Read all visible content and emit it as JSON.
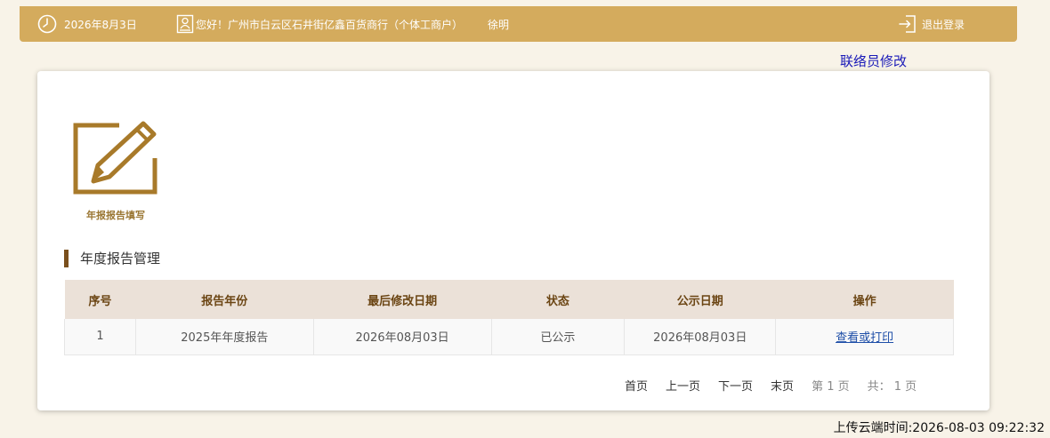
{
  "header": {
    "date": "2026年8月3日",
    "greeting": "您好！广州市白云区石井街亿鑫百货商行（个体工商户）",
    "user": "徐明",
    "logout": "退出登录"
  },
  "liaison_link": "联络员修改",
  "report_fill": {
    "label": "年报报告填写"
  },
  "section_title": "年度报告管理",
  "table": {
    "headers": [
      "序号",
      "报告年份",
      "最后修改日期",
      "状态",
      "公示日期",
      "操作"
    ],
    "rows": [
      {
        "index": "1",
        "year": "2025年年度报告",
        "modified": "2026年08月03日",
        "status": "已公示",
        "published": "2026年08月03日",
        "action": "查看或打印"
      }
    ]
  },
  "pager": {
    "first": "首页",
    "prev": "上一页",
    "next": "下一页",
    "last": "末页",
    "current": "第 1 页",
    "total": "共： 1 页"
  },
  "upload_time": "上传云端时间:2026-08-03 09:22:32",
  "colors": {
    "header_bg": "#d4ab5d",
    "accent_dark": "#7a4f1c",
    "icon_gold": "#a87a2a",
    "link": "#1a1ab8"
  }
}
